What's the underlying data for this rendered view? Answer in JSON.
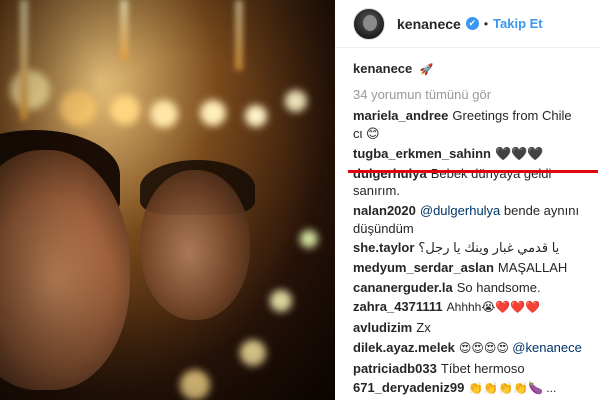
{
  "post": {
    "username": "kenanece",
    "verified_mark": "✔",
    "separator": "•",
    "follow_label": "Takip Et",
    "caption_username": "kenanece",
    "caption_text": "🚀",
    "view_all_label": "34 yorumun tümünü gör"
  },
  "comments": [
    {
      "user": "mariela_andree",
      "text": "Greetings from Chile cι 😊"
    },
    {
      "user": "tugba_erkmen_sahinn",
      "text": "🖤🖤🖤"
    },
    {
      "user": "dulgerhulya",
      "text": "Bebek dünyaya geldi sanırım."
    },
    {
      "user": "nalan2020",
      "mention": "@dulgerhulya",
      "text": " bende aynını düşündüm"
    },
    {
      "user": "she.taylor",
      "text": "يا قدمي غبار وينك يا رجل؟"
    },
    {
      "user": "medyum_serdar_aslan",
      "text": "MAŞALLAH"
    },
    {
      "user": "cananerguder.la",
      "text": "So handsome."
    },
    {
      "user": "zahra_4371111",
      "text": "Ahhhh😭❤️❤️❤️"
    },
    {
      "user": "avludizim",
      "text": "Zx"
    },
    {
      "user": "dilek.ayaz.melek",
      "text": "😍😍😍😍 ",
      "mention": "@kenanece"
    },
    {
      "user": "patriciadb033",
      "text": "Tíbet hermoso"
    },
    {
      "user": "671_deryadeniz99",
      "text": "👏👏👏👏🍆 ..."
    }
  ],
  "icons": {
    "verified": "verified-badge-icon",
    "avatar": "profile-avatar"
  },
  "colors": {
    "link_blue": "#3897f0",
    "mention_blue": "#003569",
    "muted": "#999999",
    "annotation_red": "#e0000f"
  }
}
